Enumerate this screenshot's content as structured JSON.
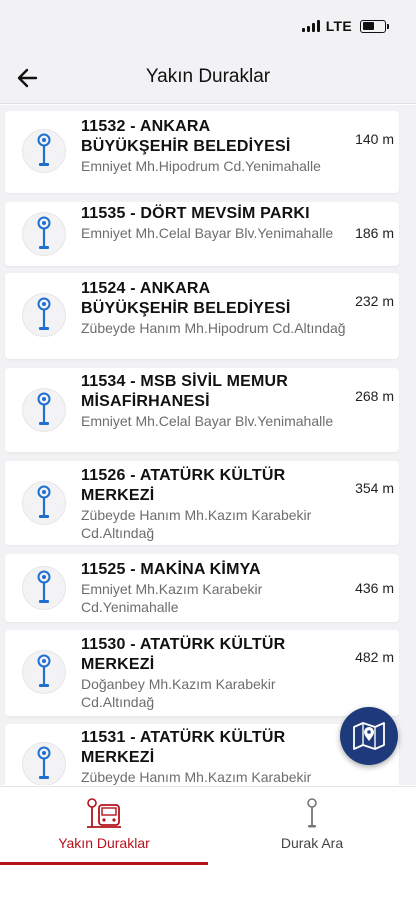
{
  "status": {
    "network": "LTE"
  },
  "header": {
    "title": "Yakın Duraklar"
  },
  "colors": {
    "accent": "#b5121b",
    "stop_icon": "#1f6fd1",
    "fab": "#1e3a7b"
  },
  "stops": [
    {
      "title": "11532 - ANKARA BÜYÜKŞEHİR BELEDİYESİ",
      "address": "Emniyet Mh.Hipodrum Cd.Yenimahalle",
      "distance": "140 m"
    },
    {
      "title": "11535 - DÖRT MEVSİM PARKI",
      "address": "Emniyet Mh.Celal Bayar Blv.Yenimahalle",
      "distance": "186 m"
    },
    {
      "title": "11524 - ANKARA BÜYÜKŞEHİR BELEDİYESİ",
      "address": "Zübeyde Hanım Mh.Hipodrum Cd.Altındağ",
      "distance": "232 m"
    },
    {
      "title": "11534 - MSB SİVİL MEMUR MİSAFİRHANESİ",
      "address": "Emniyet Mh.Celal Bayar Blv.Yenimahalle",
      "distance": "268 m"
    },
    {
      "title": "11526 - ATATÜRK KÜLTÜR MERKEZİ",
      "address": "Zübeyde Hanım Mh.Kazım Karabekir Cd.Altındağ",
      "distance": "354 m"
    },
    {
      "title": "11525 - MAKİNA KİMYA",
      "address": "Emniyet Mh.Kazım Karabekir Cd.Yenimahalle",
      "distance": "436 m"
    },
    {
      "title": "11530 - ATATÜRK KÜLTÜR MERKEZİ",
      "address": "Doğanbey Mh.Kazım Karabekir Cd.Altındağ",
      "distance": "482 m"
    },
    {
      "title": "11531 - ATATÜRK KÜLTÜR MERKEZİ",
      "address": "Zübeyde Hanım Mh.Kazım Karabekir",
      "distance": ""
    }
  ],
  "tabs": [
    {
      "label": "Yakın Duraklar",
      "icon": "bus-stop-icon",
      "active": true
    },
    {
      "label": "Durak Ara",
      "icon": "stop-pole-icon",
      "active": false
    }
  ],
  "fab": {
    "icon": "map-pin-icon"
  }
}
